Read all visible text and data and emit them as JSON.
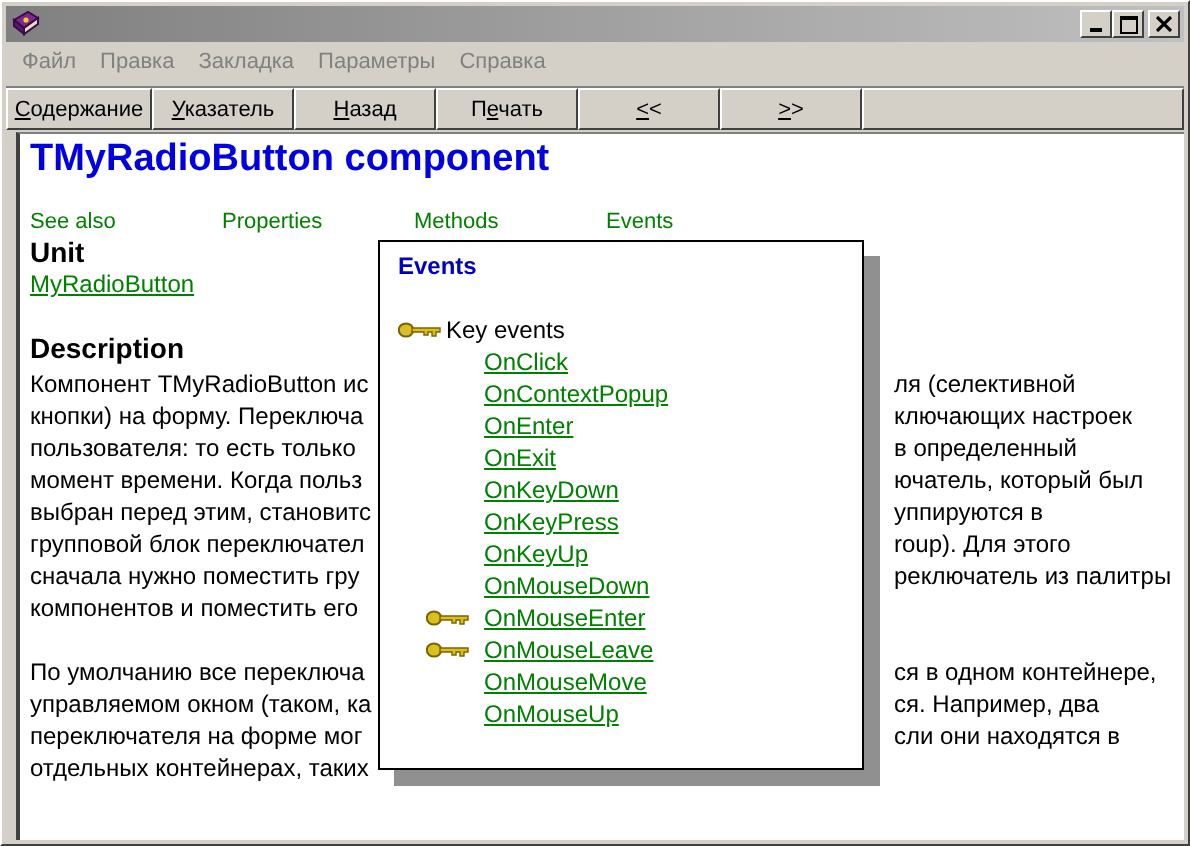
{
  "menu": [
    "Файл",
    "Правка",
    "Закладка",
    "Параметры",
    "Справка"
  ],
  "toolbar": [
    {
      "key": "С",
      "post": "одержание"
    },
    {
      "key": "У",
      "post": "казатель"
    },
    {
      "key": "Н",
      "post": "азад"
    },
    {
      "pre": "П",
      "key": "е",
      "post": "чать"
    },
    {
      "key": "<",
      "post": "<"
    },
    {
      "key": ">",
      "post": ">"
    }
  ],
  "page": {
    "title": "TMyRadioButton component",
    "links": [
      "See also",
      "Properties",
      "Methods",
      "Events"
    ],
    "unit_heading": "Unit",
    "unit_link": "MyRadioButton",
    "description_heading": "Description",
    "paragraphs": [
      {
        "lines": [
          {
            "left": "Компонент TMyRadioButton ис",
            "right": "ля (селективной"
          },
          {
            "left": "кнопки) на форму. Переключа",
            "right": "ключающих настроек"
          },
          {
            "left": "пользователя: то есть только",
            "right": "в определенный"
          },
          {
            "left": "момент времени. Когда польз",
            "right": "ючатель, который был"
          },
          {
            "left": "выбран перед этим, становитс",
            "right": "уппируются в"
          },
          {
            "left": "групповой блок переключател",
            "right": "roup). Для этого"
          },
          {
            "left": "сначала нужно поместить гру",
            "right": "реключатель из палитры"
          },
          {
            "left": "компонентов и поместить его"
          }
        ]
      },
      {
        "lines": [
          {
            "left": "По умолчанию все переключа",
            "right": "ся в одном контейнере,"
          },
          {
            "left": "управляемом окном (таком, ка",
            "right": "ся. Например, два"
          },
          {
            "left": "переключателя на форме мог",
            "right": "сли они находятся в"
          },
          {
            "left": "отдельных контейнерах, таких"
          }
        ]
      }
    ]
  },
  "popup": {
    "title": "Events",
    "group": "Key events",
    "items": [
      {
        "label": "OnClick",
        "key": false
      },
      {
        "label": "OnContextPopup",
        "key": false
      },
      {
        "label": "OnEnter",
        "key": false
      },
      {
        "label": "OnExit",
        "key": false
      },
      {
        "label": "OnKeyDown",
        "key": false
      },
      {
        "label": "OnKeyPress",
        "key": false
      },
      {
        "label": "OnKeyUp",
        "key": false
      },
      {
        "label": "OnMouseDown",
        "key": false
      },
      {
        "label": "OnMouseEnter",
        "key": true
      },
      {
        "label": "OnMouseLeave",
        "key": true
      },
      {
        "label": "OnMouseMove",
        "key": false
      },
      {
        "label": "OnMouseUp",
        "key": false
      }
    ]
  }
}
